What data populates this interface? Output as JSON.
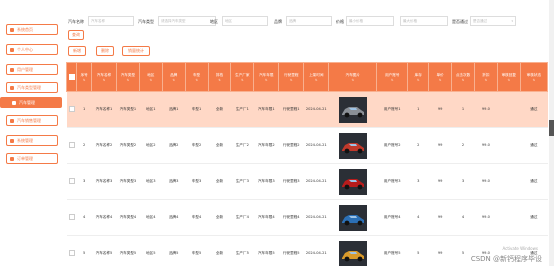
{
  "sidebar": {
    "items": [
      {
        "label": "系统首页"
      },
      {
        "label": "个人中心"
      },
      {
        "label": "用户管理"
      },
      {
        "label": "汽车类型管理"
      },
      {
        "label": "汽车管理"
      },
      {
        "label": "汽车销售管理"
      },
      {
        "label": "系统管理"
      },
      {
        "label": "订单管理"
      }
    ]
  },
  "search": {
    "fields": [
      {
        "label": "汽车名称",
        "placeholder": "汽车名称"
      },
      {
        "label": "汽车类型",
        "placeholder": "请选择汽车类型"
      },
      {
        "label": "地区",
        "placeholder": "地区"
      },
      {
        "label": "品牌",
        "placeholder": "品牌"
      },
      {
        "label": "价格",
        "placeholder": "最小价格"
      },
      {
        "label": "",
        "placeholder": "最大价格"
      },
      {
        "label": "是否通过",
        "placeholder": "是否通过"
      }
    ],
    "query_label": "查询"
  },
  "toolbar": {
    "add_label": "新增",
    "delete_label": "删除",
    "report_label": "销量统计"
  },
  "table": {
    "headers": [
      "序号",
      "汽车名称",
      "汽车类型",
      "地区",
      "品牌",
      "车型",
      "排档",
      "生产厂家",
      "汽车年限",
      "行驶里程",
      "上架时间",
      "汽车图片",
      "用户账号",
      "库存",
      "单价",
      "点击次数",
      "折扣",
      "审核回复",
      "审核状态"
    ],
    "rows": [
      {
        "no": "1",
        "name": "汽车名称1",
        "type": "汽车类型1",
        "region": "地区1",
        "brand": "品牌1",
        "model": "车型1",
        "gear": "全新",
        "maker": "生产厂1",
        "year": "汽车年限1",
        "mileage": "行驶里程1",
        "date": "2024-04-21",
        "user": "用户账号1",
        "stock": "1",
        "price": "99",
        "clicks": "1",
        "discount": "99.0",
        "reply": "",
        "status": "通过"
      },
      {
        "no": "2",
        "name": "汽车名称2",
        "type": "汽车类型2",
        "region": "地区2",
        "brand": "品牌2",
        "model": "车型2",
        "gear": "全新",
        "maker": "生产厂2",
        "year": "汽车年限2",
        "mileage": "行驶里程2",
        "date": "2024-04-21",
        "user": "用户账号2",
        "stock": "2",
        "price": "99",
        "clicks": "2",
        "discount": "99.0",
        "reply": "",
        "status": "通过"
      },
      {
        "no": "3",
        "name": "汽车名称3",
        "type": "汽车类型3",
        "region": "地区3",
        "brand": "品牌3",
        "model": "车型3",
        "gear": "全新",
        "maker": "生产厂3",
        "year": "汽车年限3",
        "mileage": "行驶里程3",
        "date": "2024-04-21",
        "user": "用户账号3",
        "stock": "3",
        "price": "99",
        "clicks": "3",
        "discount": "99.0",
        "reply": "",
        "status": "通过"
      },
      {
        "no": "4",
        "name": "汽车名称4",
        "type": "汽车类型4",
        "region": "地区4",
        "brand": "品牌4",
        "model": "车型4",
        "gear": "全新",
        "maker": "生产厂4",
        "year": "汽车年限4",
        "mileage": "行驶里程4",
        "date": "2024-04-21",
        "user": "用户账号4",
        "stock": "4",
        "price": "99",
        "clicks": "4",
        "discount": "99.0",
        "reply": "",
        "status": "通过"
      },
      {
        "no": "5",
        "name": "汽车名称5",
        "type": "汽车类型5",
        "region": "地区5",
        "brand": "品牌5",
        "model": "车型5",
        "gear": "全新",
        "maker": "生产厂5",
        "year": "汽车年限5",
        "mileage": "行驶里程5",
        "date": "2024-04-21",
        "user": "用户账号5",
        "stock": "5",
        "price": "99",
        "clicks": "5",
        "discount": "99.0",
        "reply": "",
        "status": "通过"
      }
    ]
  },
  "watermark": {
    "main": "CSDN @新钙程序毕设",
    "small": "Activate Windows"
  },
  "colors": {
    "accent": "#f47a47",
    "highlight_row": "#ffd8c6"
  },
  "car_colors": [
    "#8a8f96",
    "#c0392b",
    "#b71c1c",
    "#2b6fb5",
    "#d99a2b"
  ]
}
